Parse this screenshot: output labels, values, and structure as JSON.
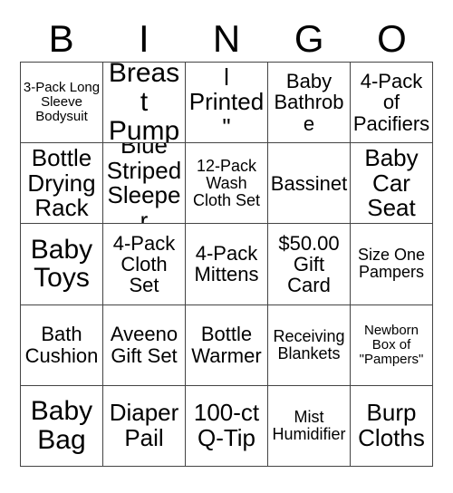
{
  "card": {
    "title_letters": [
      "B",
      "I",
      "N",
      "G",
      "O"
    ],
    "background_color": "#ffffff",
    "text_color": "#000000",
    "border_color": "#444444",
    "rows": 5,
    "columns": 5,
    "cells": [
      {
        "text": "3-Pack Long Sleeve Bodysuit",
        "size": "xs"
      },
      {
        "text": "Breast Pump",
        "size": "xl"
      },
      {
        "text": "\"Animal Printed\" Boppy",
        "size": "lg"
      },
      {
        "text": "Baby Bathrobe",
        "size": "md"
      },
      {
        "text": "4-Pack of Pacifiers",
        "size": "md"
      },
      {
        "text": "Bottle Drying Rack",
        "size": "lg"
      },
      {
        "text": "Blue Striped Sleeper",
        "size": "lg"
      },
      {
        "text": "12-Pack Wash Cloth Set",
        "size": "sm"
      },
      {
        "text": "Bassinet",
        "size": "md"
      },
      {
        "text": "Baby Car Seat",
        "size": "lg"
      },
      {
        "text": "Baby Toys",
        "size": "xl"
      },
      {
        "text": "4-Pack Cloth Set",
        "size": "md"
      },
      {
        "text": "4-Pack Mittens",
        "size": "md"
      },
      {
        "text": "$50.00 Gift Card",
        "size": "md"
      },
      {
        "text": "Size One Pampers",
        "size": "sm"
      },
      {
        "text": "Bath Cushion",
        "size": "md"
      },
      {
        "text": "Aveeno Gift Set",
        "size": "md"
      },
      {
        "text": "Bottle Warmer",
        "size": "md"
      },
      {
        "text": "Receiving Blankets",
        "size": "sm"
      },
      {
        "text": "Newborn Box of \"Pampers\"",
        "size": "xs"
      },
      {
        "text": "Baby Bag",
        "size": "xl"
      },
      {
        "text": "Diaper Pail",
        "size": "lg"
      },
      {
        "text": "100-ct Q-Tip",
        "size": "lg"
      },
      {
        "text": "Mist Humidifier",
        "size": "sm"
      },
      {
        "text": "Burp Cloths",
        "size": "lg"
      }
    ]
  }
}
